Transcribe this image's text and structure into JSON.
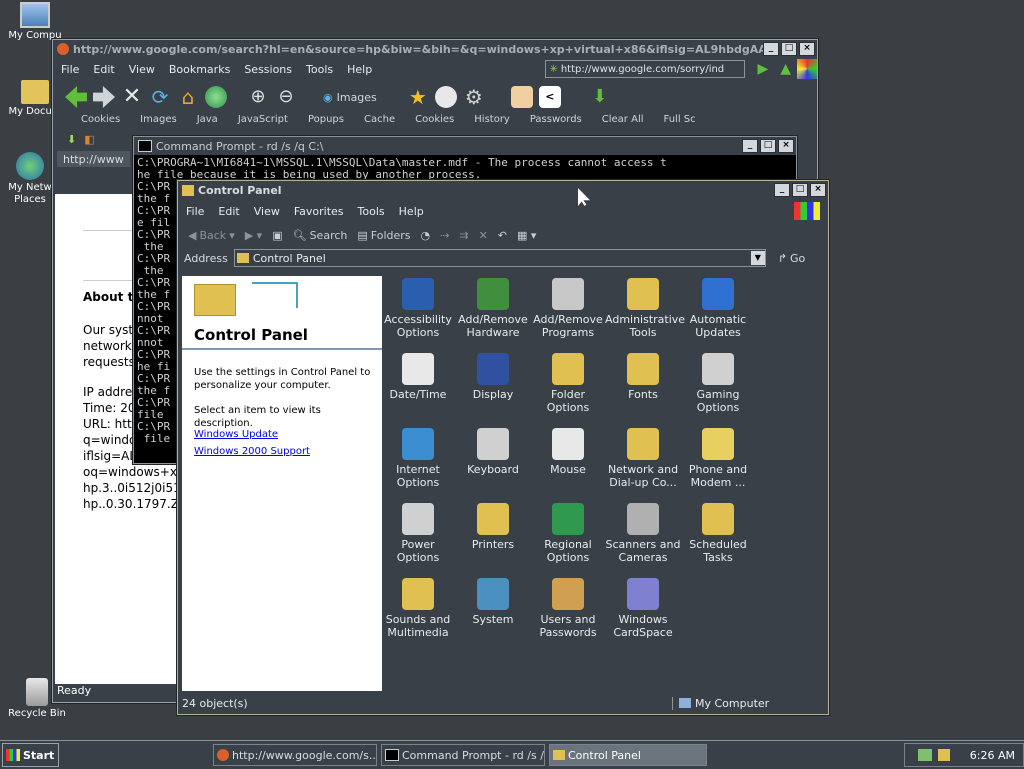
{
  "desktop": {
    "icons": [
      {
        "label": "My Compu",
        "icon": "my-computer-icon"
      },
      {
        "label": "My Docum",
        "icon": "my-documents-icon"
      },
      {
        "label": "My Netw Places",
        "icon": "my-network-places-icon"
      },
      {
        "label": "Recycle Bin",
        "icon": "recycle-bin-icon"
      }
    ]
  },
  "browser": {
    "title": "http://www.google.com/search?hl=en&source=hp&biw=&bih=&q=windows+xp+virtual+x86&iflsig=AL9hbdgAAAAAZ...",
    "menu": [
      "File",
      "Edit",
      "View",
      "Bookmarks",
      "Sessions",
      "Tools",
      "Help"
    ],
    "url": "http://www.google.com/sorry/ind",
    "images_label": "Images",
    "bookmarks": [
      "Cookies",
      "Images",
      "Java",
      "JavaScript",
      "Popups",
      "Cache",
      "Cookies",
      "History",
      "Passwords",
      "Clear All",
      "Full Sc"
    ],
    "tab": "http://www",
    "page": {
      "heading": "About th",
      "para1": [
        "Our syst",
        "network",
        "requests"
      ],
      "para2": [
        "IP addre",
        "Time: 20",
        "URL: htt",
        "q=windo",
        "iflsig=AL",
        "oq=windows+xp",
        "hp.3..0i512j0i512",
        "hp..0.30.1797.Zv"
      ]
    },
    "status": "Ready"
  },
  "cmd": {
    "title": "Command Prompt - rd /s /q C:\\",
    "lines": [
      "C:\\PROGRA~1\\MI6841~1\\MSSQL.1\\MSSQL\\Data\\master.mdf - The process cannot access t",
      "he file because it is being used by another process.",
      "C:\\PR",
      "the f",
      "C:\\PR",
      "e fil",
      "C:\\PR",
      " the",
      "C:\\PR",
      " the",
      "C:\\PR",
      "the f",
      "C:\\PR",
      "nnot",
      "C:\\PR",
      "nnot",
      "C:\\PR",
      "he fi",
      "C:\\PR",
      "the f",
      "C:\\PR",
      "file",
      "C:\\PR",
      " file"
    ]
  },
  "control_panel": {
    "title": "Control Panel",
    "menu": [
      "File",
      "Edit",
      "View",
      "Favorites",
      "Tools",
      "Help"
    ],
    "toolbar": {
      "back": "Back",
      "search": "Search",
      "folders": "Folders"
    },
    "address_label": "Address",
    "address_value": "Control Panel",
    "go_label": "Go",
    "left": {
      "title": "Control Panel",
      "text1": "Use the settings in Control Panel to personalize your computer.",
      "text2": "Select an item to view its description.",
      "link1": "Windows Update",
      "link2": "Windows 2000 Support"
    },
    "items": [
      {
        "label": "Accessibility Options",
        "icon": "accessibility-icon",
        "color": "#2a5fb0"
      },
      {
        "label": "Add/Remove Hardware",
        "icon": "hardware-icon",
        "color": "#3f8f3f"
      },
      {
        "label": "Add/Remove Programs",
        "icon": "programs-icon",
        "color": "#c8c8c8"
      },
      {
        "label": "Administrative Tools",
        "icon": "admin-tools-icon",
        "color": "#e0c050"
      },
      {
        "label": "Automatic Updates",
        "icon": "updates-icon",
        "color": "#3070d0"
      },
      {
        "label": "Date/Time",
        "icon": "date-time-icon",
        "color": "#e8e8e8"
      },
      {
        "label": "Display",
        "icon": "display-icon",
        "color": "#3050a0"
      },
      {
        "label": "Folder Options",
        "icon": "folder-options-icon",
        "color": "#e0c050"
      },
      {
        "label": "Fonts",
        "icon": "fonts-icon",
        "color": "#e0c050"
      },
      {
        "label": "Gaming Options",
        "icon": "gaming-icon",
        "color": "#d0d0d0"
      },
      {
        "label": "Internet Options",
        "icon": "internet-icon",
        "color": "#3b8fd0"
      },
      {
        "label": "Keyboard",
        "icon": "keyboard-icon",
        "color": "#d0d0d0"
      },
      {
        "label": "Mouse",
        "icon": "mouse-icon",
        "color": "#e8e8e8"
      },
      {
        "label": "Network and Dial-up Co...",
        "icon": "network-icon",
        "color": "#e0c050"
      },
      {
        "label": "Phone and Modem ...",
        "icon": "phone-icon",
        "color": "#e8d060"
      },
      {
        "label": "Power Options",
        "icon": "power-icon",
        "color": "#d0d0d0"
      },
      {
        "label": "Printers",
        "icon": "printers-icon",
        "color": "#e0c050"
      },
      {
        "label": "Regional Options",
        "icon": "regional-icon",
        "color": "#2f9a4f"
      },
      {
        "label": "Scanners and Cameras",
        "icon": "scanner-icon",
        "color": "#b0b0b0"
      },
      {
        "label": "Scheduled Tasks",
        "icon": "tasks-icon",
        "color": "#e0c050"
      },
      {
        "label": "Sounds and Multimedia",
        "icon": "sounds-icon",
        "color": "#e0c050"
      },
      {
        "label": "System",
        "icon": "system-icon",
        "color": "#4a90c0"
      },
      {
        "label": "Users and Passwords",
        "icon": "users-icon",
        "color": "#d0a050"
      },
      {
        "label": "Windows CardSpace",
        "icon": "cardspace-icon",
        "color": "#8080d0"
      }
    ],
    "status_count": "24 object(s)",
    "status_zone": "My Computer"
  },
  "taskbar": {
    "start": "Start",
    "buttons": [
      {
        "label": "http://www.google.com/s...",
        "active": false
      },
      {
        "label": "Command Prompt - rd /s /...",
        "active": false
      },
      {
        "label": "Control Panel",
        "active": true
      }
    ],
    "clock": "6:26 AM"
  }
}
